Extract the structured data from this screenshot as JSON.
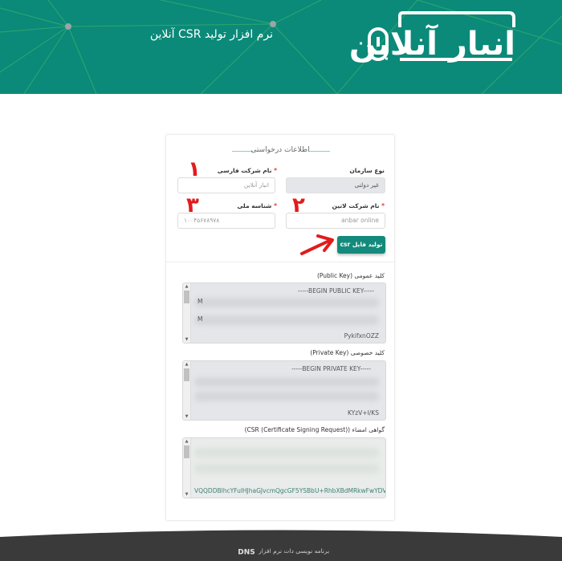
{
  "header": {
    "subtitle": "نرم افزار تولید CSR آنلاین",
    "logo_text": "انبار آنلاین",
    "bg_color": "#0b8a79"
  },
  "form": {
    "section_title": "اطلاعات درخواستی",
    "org_type": {
      "label": "نوع سازمان",
      "value": "غیر دولتی"
    },
    "company_fa": {
      "label": "نام شرکت فارسی",
      "placeholder": "انبار آنلاین"
    },
    "company_en": {
      "label": "نام شرکت لاتین",
      "placeholder": "anbar online"
    },
    "national_id": {
      "label": "شناسه ملی",
      "placeholder": "۱۰۰۴۵۶۷۸۹۷۸"
    },
    "submit_label": "تولید فایل csr",
    "required_mark": "*"
  },
  "annotations": {
    "one": "۱",
    "two": "۲",
    "three": "۳"
  },
  "keys": {
    "public": {
      "label": "کلید عمومی (Public Key)",
      "header": "-----BEGIN PUBLIC KEY-----",
      "first_char": "M",
      "second_char": "M",
      "tail": "PykifxnOZZ"
    },
    "private": {
      "label": "کلید خصوصی (Private Key)",
      "header": "-----BEGIN PRIVATE KEY-----",
      "tail": "KYzV+I/KS"
    },
    "csr": {
      "label": "گواهی امضاء (CSR (Certificate Signing Request))",
      "tail": "VQQDDBlhcYFulHJhaGJvcmQgcGF5YSBbU+RhbXBdMRkwFwYDVQ"
    }
  },
  "footer": {
    "text": "برنامه نویسی دات نرم افزار",
    "brand": "DNS"
  }
}
